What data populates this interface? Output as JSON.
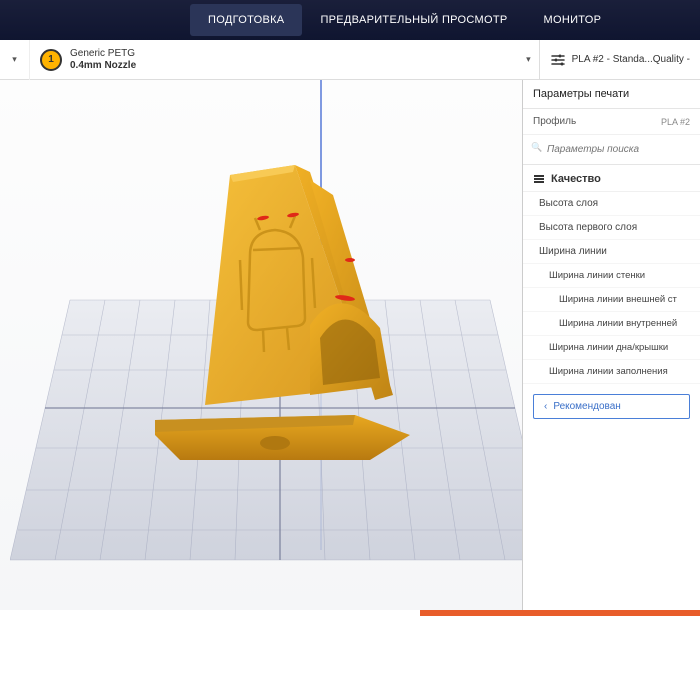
{
  "tabs": {
    "prepare": "ПОДГОТОВКА",
    "preview": "ПРЕДВАРИТЕЛЬНЫЙ ПРОСМОТР",
    "monitor": "МОНИТОР"
  },
  "material": {
    "name": "Generic PETG",
    "nozzle": "0.4mm Nozzle",
    "badge": "1"
  },
  "profileBar": "PLA #2 - Standa...Quality -",
  "panel": {
    "title": "Параметры печати",
    "profileLabel": "Профиль",
    "profileValue": "PLA #2",
    "searchPlaceholder": "Параметры поиска",
    "quality": "Качество",
    "items": {
      "layerHeight": "Высота слоя",
      "initialLayer": "Высота первого слоя",
      "lineWidth": "Ширина линии",
      "wallLine": "Ширина линии стенки",
      "outerWall": "Ширина линии внешней ст",
      "innerWall": "Ширина линии внутренней",
      "topBottom": "Ширина линии дна/крышки",
      "infillLine": "Ширина линии заполнения"
    },
    "recommend": "Рекомендован"
  }
}
